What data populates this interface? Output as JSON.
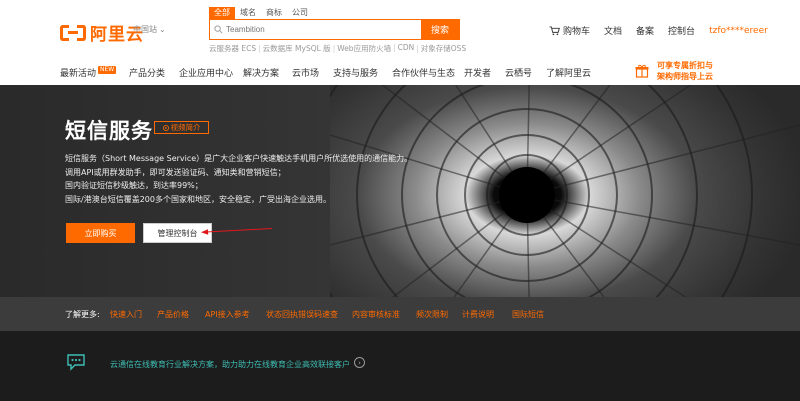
{
  "header": {
    "logo_text": "阿里云",
    "region": "中国站",
    "search": {
      "tabs": [
        "全部",
        "域名",
        "商标",
        "公司"
      ],
      "placeholder": "Teambition",
      "button": "搜索",
      "hot_links": [
        "云服务器 ECS",
        "云数据库 MySQL 版",
        "Web应用防火墙",
        "CDN",
        "对象存储OSS"
      ]
    },
    "right": {
      "cart": "购物车",
      "docs": "文档",
      "beian": "备案",
      "console": "控制台",
      "user": "tzfo****ereer"
    }
  },
  "nav": {
    "items": [
      "最新活动",
      "产品分类",
      "企业应用中心",
      "解决方案",
      "云市场",
      "支持与服务",
      "合作伙伴与生态",
      "开发者",
      "云栖号",
      "了解阿里云"
    ],
    "new_badge": "NEW",
    "promo_line1": "可享专属折扣与",
    "promo_line2": "架构师指导上云"
  },
  "hero": {
    "title": "短信服务",
    "video_label": "视频简介",
    "desc": [
      "短信服务（Short Message Service）是广大企业客户快速触达手机用户所优选使用的通信能力。",
      "调用API或用群发助手，即可发送验证码、通知类和营销短信；",
      "国内验证短信秒级触达，到达率99%；",
      "国际/港澳台短信覆盖200多个国家和地区，安全稳定，广受出海企业选用。"
    ],
    "buy_button": "立即购买",
    "console_button": "管理控制台"
  },
  "learn_more": {
    "label": "了解更多:",
    "links": [
      "快速入门",
      "产品价格",
      "API接入参考",
      "状态回执错误码速查",
      "内容审核标准",
      "频次限制",
      "计费说明",
      "国际短信"
    ]
  },
  "bottom": {
    "text": "云通信在线教育行业解决方案，助力助力在线教育企业高效联接客户"
  },
  "colors": {
    "accent": "#ff6a00",
    "teal": "#3ebeb4"
  }
}
